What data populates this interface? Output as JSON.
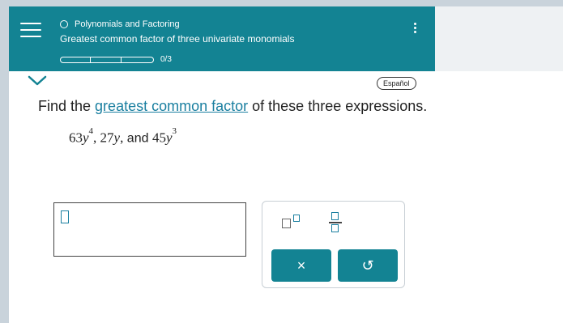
{
  "header": {
    "topic": "Polynomials and Factoring",
    "lesson_title": "Greatest common factor of three univariate monomials",
    "progress_text": "0/3",
    "progress_fraction": 0,
    "accent_color": "#138393"
  },
  "language_button": "Español",
  "question": {
    "prefix": "Find the ",
    "link_text": "greatest common factor",
    "suffix": " of these three expressions."
  },
  "expressions": {
    "e1_coef": "63",
    "e1_var": "y",
    "e1_exp": "4",
    "sep1": ", ",
    "e2_coef": "27",
    "e2_var": "y",
    "sep2": ",",
    "and_word": " and ",
    "e3_coef": "45",
    "e3_var": "y",
    "e3_exp": "3"
  },
  "palette": {
    "clear_symbol": "×",
    "undo_symbol": "↺"
  },
  "icons": [
    "menu-icon",
    "circle-icon",
    "kebab-icon",
    "chevron-down-icon",
    "exponent-icon",
    "fraction-icon",
    "clear-icon",
    "undo-icon"
  ]
}
